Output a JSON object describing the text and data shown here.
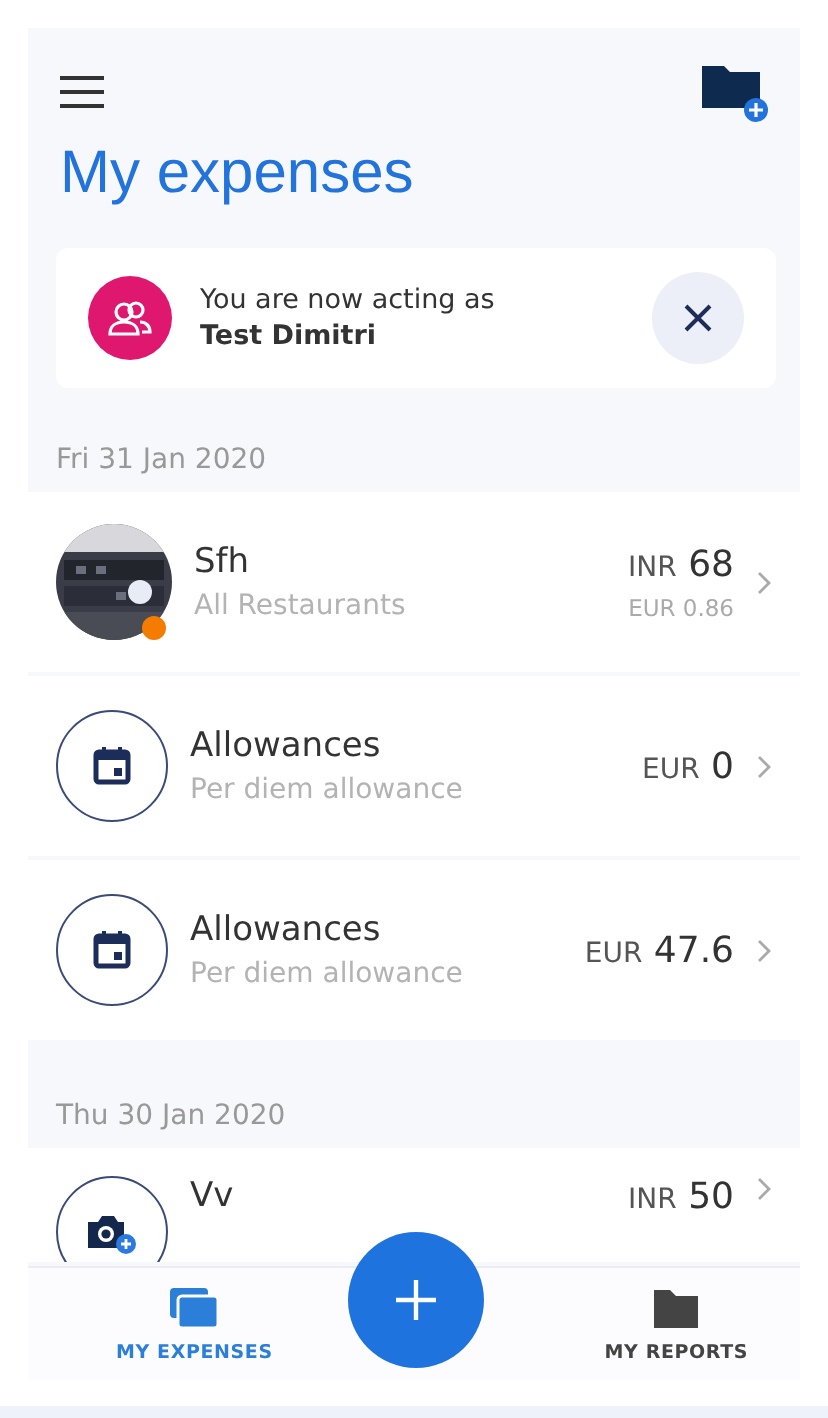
{
  "header": {
    "title": "My expenses"
  },
  "banner": {
    "text": "You are now acting as",
    "name": "Test Dimitri"
  },
  "groups": [
    {
      "date": "Fri 31 Jan 2020",
      "expenses": [
        {
          "title": "Sfh",
          "subtitle": "All Restaurants",
          "currency": "INR",
          "amount": "68",
          "converted": "EUR 0.86",
          "color": "#f57c00"
        },
        {
          "kind": "allowance",
          "title": "Allowances",
          "subtitle": "Per diem allowance",
          "currency": "EUR",
          "amount": "0"
        },
        {
          "kind": "allowance",
          "title": "Allowances",
          "subtitle": "Per diem allowance",
          "currency": "EUR",
          "amount": "47.6"
        }
      ]
    },
    {
      "date": "Thu 30 Jan 2020",
      "expenses": [
        {
          "kind": "receipt",
          "title": "Vv",
          "currency": "INR",
          "amount": "50"
        }
      ]
    }
  ],
  "tabs": [
    {
      "kind": "expenses",
      "label": "MY EXPENSES",
      "selected": true
    },
    {
      "kind": "reports",
      "label": "MY REPORTS",
      "selected": false
    }
  ]
}
